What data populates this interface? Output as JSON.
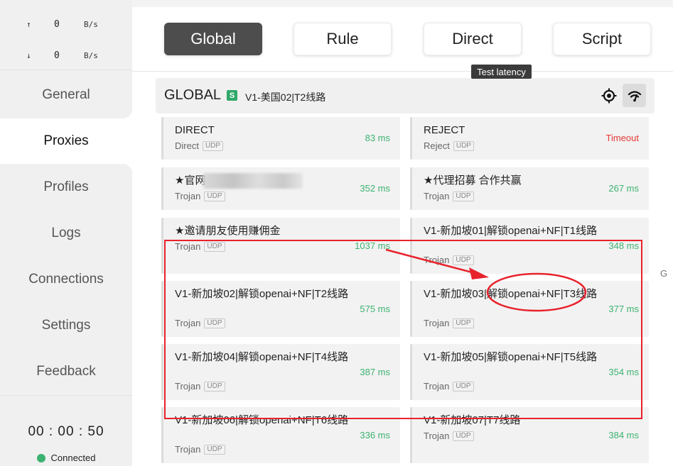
{
  "traffic": {
    "up_arrow": "↑",
    "up_value": "0",
    "up_unit": "B/s",
    "down_arrow": "↓",
    "down_value": "0",
    "down_unit": "B/s"
  },
  "nav": [
    {
      "label": "General",
      "name": "nav-general"
    },
    {
      "label": "Proxies",
      "name": "nav-proxies",
      "active": true
    },
    {
      "label": "Profiles",
      "name": "nav-profiles"
    },
    {
      "label": "Logs",
      "name": "nav-logs"
    },
    {
      "label": "Connections",
      "name": "nav-connections"
    },
    {
      "label": "Settings",
      "name": "nav-settings"
    },
    {
      "label": "Feedback",
      "name": "nav-feedback"
    }
  ],
  "status": {
    "timer": "00 : 00 : 50",
    "connection": "Connected",
    "dot_color": "#3cb371"
  },
  "modes": {
    "global": "Global",
    "rule": "Rule",
    "direct": "Direct",
    "script": "Script",
    "active": "Global"
  },
  "tooltip": "Test latency",
  "group": {
    "title": "GLOBAL",
    "badge": "S",
    "selected": "V1-美国02|T2线路",
    "locate_icon": "crosshair-icon",
    "latency_icon": "wifi-speed-icon"
  },
  "proxies": [
    {
      "name": "DIRECT",
      "type": "Direct",
      "udp": "UDP",
      "delay": "83 ms"
    },
    {
      "name": "REJECT",
      "type": "Reject",
      "udp": "UDP",
      "delay": "Timeout",
      "timeout": true
    },
    {
      "name": "★官网",
      "type": "Trojan",
      "udp": "UDP",
      "delay": "352 ms",
      "blurred": true
    },
    {
      "name": "★代理招募 合作共赢",
      "type": "Trojan",
      "udp": "UDP",
      "delay": "267 ms"
    },
    {
      "name": "★邀请朋友使用赚佣金",
      "type": "Trojan",
      "udp": "UDP",
      "delay": "1037 ms"
    },
    {
      "name": "V1-新加坡01|解锁openai+NF|T1线路",
      "type": "Trojan",
      "udp": "UDP",
      "delay": "348 ms"
    },
    {
      "name": "V1-新加坡02|解锁openai+NF|T2线路",
      "type": "Trojan",
      "udp": "UDP",
      "delay": "575 ms"
    },
    {
      "name": "V1-新加坡03|解锁openai+NF|T3线路",
      "type": "Trojan",
      "udp": "UDP",
      "delay": "377 ms"
    },
    {
      "name": "V1-新加坡04|解锁openai+NF|T4线路",
      "type": "Trojan",
      "udp": "UDP",
      "delay": "387 ms"
    },
    {
      "name": "V1-新加坡05|解锁openai+NF|T5线路",
      "type": "Trojan",
      "udp": "UDP",
      "delay": "354 ms"
    },
    {
      "name": "V1-新加坡06|解锁openai+NF|T6线路",
      "type": "Trojan",
      "udp": "UDP",
      "delay": "336 ms"
    },
    {
      "name": "V1-新加坡07|T7线路",
      "type": "Trojan",
      "udp": "UDP",
      "delay": "384 ms"
    }
  ],
  "edge_char": "G",
  "annotation_color": "#e8222b"
}
